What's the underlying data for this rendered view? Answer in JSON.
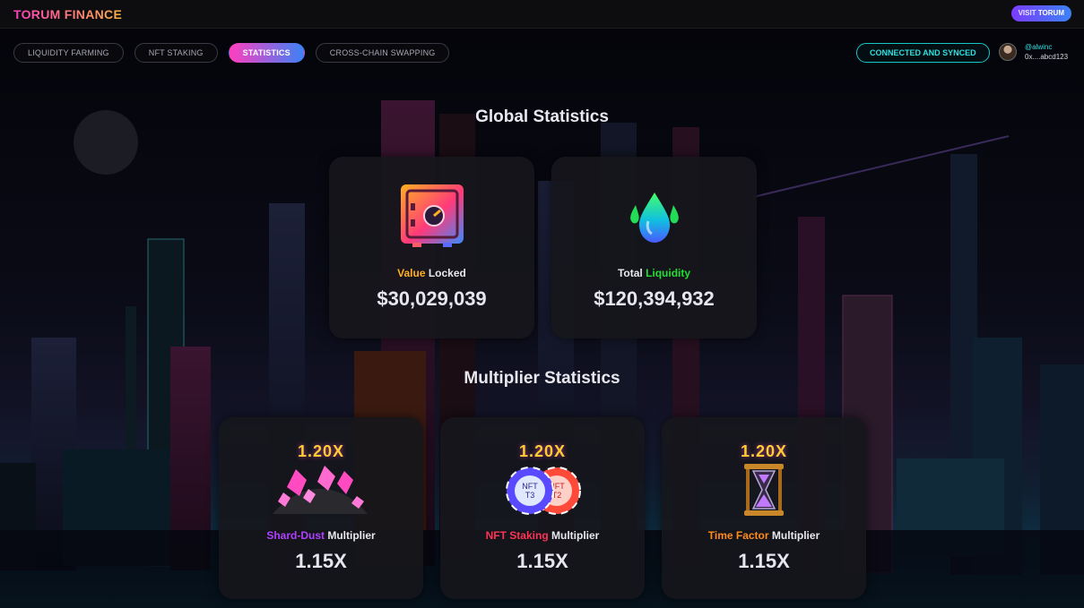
{
  "header": {
    "brand": "TORUM FINANCE",
    "visit_prefix": "VISIT",
    "visit_name": "TORUM"
  },
  "nav": {
    "tabs": [
      {
        "label": "LIQUIDITY FARMING",
        "active": false
      },
      {
        "label": "NFT STAKING",
        "active": false
      },
      {
        "label": "STATISTICS",
        "active": true
      },
      {
        "label": "CROSS-CHAIN SWAPPING",
        "active": false
      }
    ]
  },
  "status": {
    "label": "CONNECTED AND SYNCED"
  },
  "user": {
    "handle": "@alwinc",
    "wallet": "0x....abcd123"
  },
  "global": {
    "title": "Global Statistics",
    "value_locked": {
      "label_highlight": "Value",
      "label_rest": "Locked",
      "value": "$30,029,039",
      "icon": "safe-icon",
      "highlight_color": "#ffb020"
    },
    "total_liquidity": {
      "label_rest": "Total",
      "label_highlight": "Liquidity",
      "value": "$120,394,932",
      "icon": "droplets-icon",
      "highlight_color": "#22dd33"
    }
  },
  "multiplier": {
    "title": "Multiplier Statistics",
    "cards": [
      {
        "badge": "1.20X",
        "label_highlight": "Shard-Dust",
        "label_rest": "Multiplier",
        "value": "1.15X",
        "icon": "crystal-pile-icon",
        "highlight_color": "#b040ff"
      },
      {
        "badge": "1.20X",
        "label_highlight": "NFT Staking",
        "label_rest": "Multiplier",
        "value": "1.15X",
        "icon": "nft-chips-icon",
        "chip_labels": [
          "NFT T3",
          "NFT T2"
        ],
        "highlight_color": "#ff3355"
      },
      {
        "badge": "1.20X",
        "label_highlight": "Time Factor",
        "label_rest": "Multiplier",
        "value": "1.15X",
        "icon": "hourglass-icon",
        "highlight_color": "#ff8a1f"
      }
    ]
  }
}
